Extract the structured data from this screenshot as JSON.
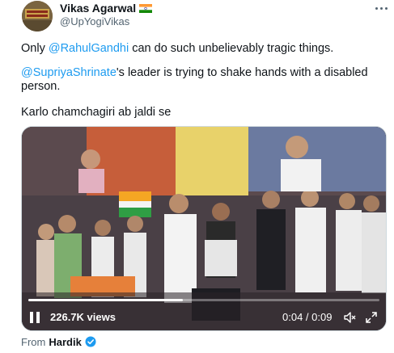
{
  "tweet": {
    "author_name": "Vikas Agarwal",
    "author_handle": "@UpYogiVikas",
    "lines": {
      "line1_mention": "@RahulGandhi",
      "line1_prefix": "Only ",
      "line1_suffix": " can do such unbelievably tragic things.",
      "line2_mention": "@SupriyaShrinate",
      "line2_suffix": "'s leader is trying to shake hands with a disabled person.",
      "line3": "Karlo chamchagiri ab jaldi se"
    }
  },
  "video": {
    "views": "226.7K views",
    "time": "0:04 / 0:09",
    "progress_fraction": 0.44
  },
  "attribution": {
    "from_label": "From",
    "from_name": "Hardik"
  },
  "colors": {
    "link": "#1d9bf0",
    "secondary_text": "#536471",
    "verified": "#1d9bf0"
  },
  "icons": [
    "more-icon",
    "pause-icon",
    "mute-icon",
    "fullscreen-icon",
    "verified-badge-icon",
    "india-flag-icon"
  ]
}
